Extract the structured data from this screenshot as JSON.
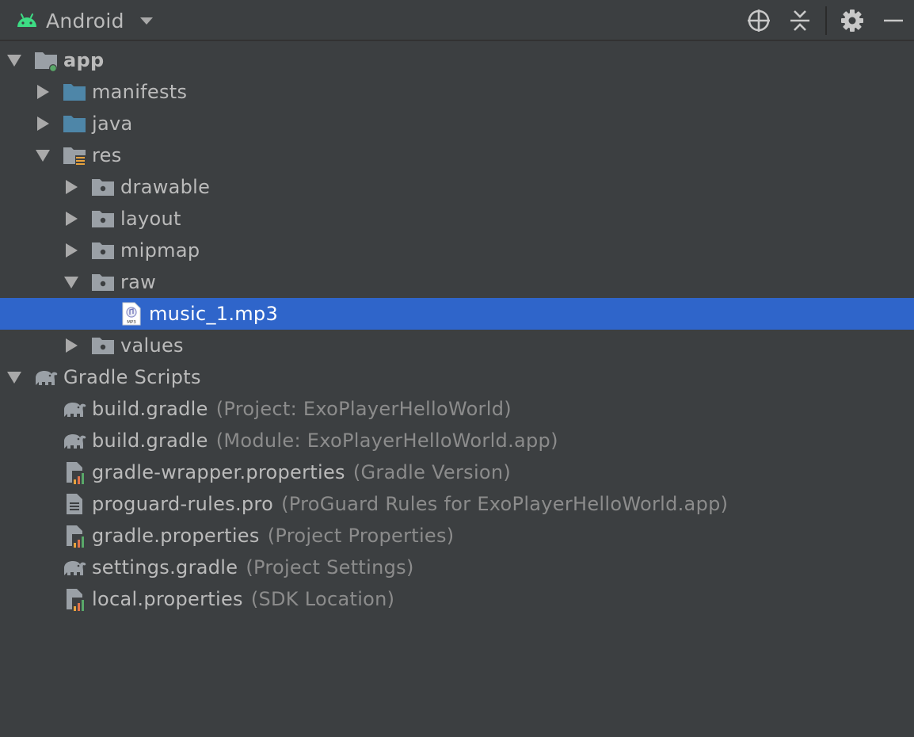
{
  "header": {
    "view_label": "Android",
    "icons": [
      "android-icon",
      "dropdown-caret-icon",
      "locate-icon",
      "collapse-all-icon",
      "gear-icon",
      "minimize-icon"
    ]
  },
  "tree": {
    "app": "app",
    "manifests": "manifests",
    "java": "java",
    "res": "res",
    "drawable": "drawable",
    "layout": "layout",
    "mipmap": "mipmap",
    "raw": "raw",
    "music": "music_1.mp3",
    "values": "values",
    "gradle_scripts": "Gradle Scripts",
    "gradle_files": [
      {
        "name": "build.gradle",
        "hint": "(Project: ExoPlayerHelloWorld)",
        "icon": "gradle-icon"
      },
      {
        "name": "build.gradle",
        "hint": "(Module: ExoPlayerHelloWorld.app)",
        "icon": "gradle-icon"
      },
      {
        "name": "gradle-wrapper.properties",
        "hint": "(Gradle Version)",
        "icon": "properties-icon"
      },
      {
        "name": "proguard-rules.pro",
        "hint": "(ProGuard Rules for ExoPlayerHelloWorld.app)",
        "icon": "text-file-icon"
      },
      {
        "name": "gradle.properties",
        "hint": "(Project Properties)",
        "icon": "properties-icon"
      },
      {
        "name": "settings.gradle",
        "hint": "(Project Settings)",
        "icon": "gradle-icon"
      },
      {
        "name": "local.properties",
        "hint": "(SDK Location)",
        "icon": "properties-icon"
      }
    ]
  },
  "colors": {
    "background": "#3c3f41",
    "selection": "#2f65ca",
    "text": "#bbbbbb",
    "hint_text": "#8c8c8c",
    "android_green": "#3ddc84",
    "folder_blue": "#4e86a8"
  }
}
